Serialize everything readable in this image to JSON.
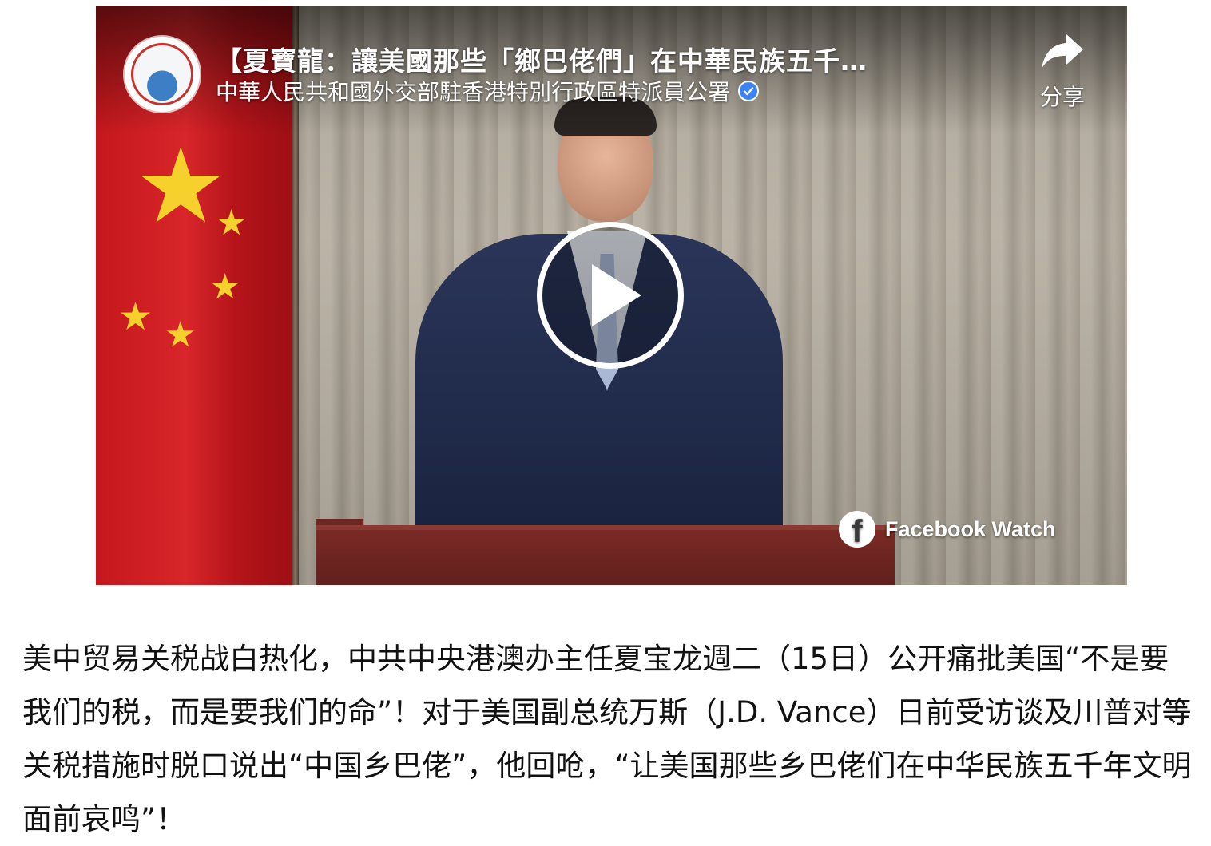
{
  "video": {
    "title": "【夏寶龍：讓美國那些「鄉巴佬們」在中華民族五千…",
    "channel_name": "中華人民共和國外交部駐香港特別行政區特派員公署",
    "share_label": "分享",
    "watermark": "Facebook Watch",
    "icons": {
      "share": "share-arrow-icon",
      "verified": "verified-badge-icon",
      "play": "play-icon",
      "facebook": "facebook-icon"
    },
    "colors": {
      "flag_red": "#d8262a",
      "star_yellow": "#f6d12b",
      "verified_blue": "#3b82f6"
    }
  },
  "article": {
    "paragraph": "美中贸易关税战白热化，中共中央港澳办主任夏宝龙週二（15日）公开痛批美国“不是要我们的税，而是要我们的命”！对于美国副总统万斯（J.D. Vance）日前受访谈及川普对等关税措施时脱口说出“中国乡巴佬”，他回呛，“让美国那些乡巴佬们在中华民族五千年文明面前哀鸣”！"
  }
}
